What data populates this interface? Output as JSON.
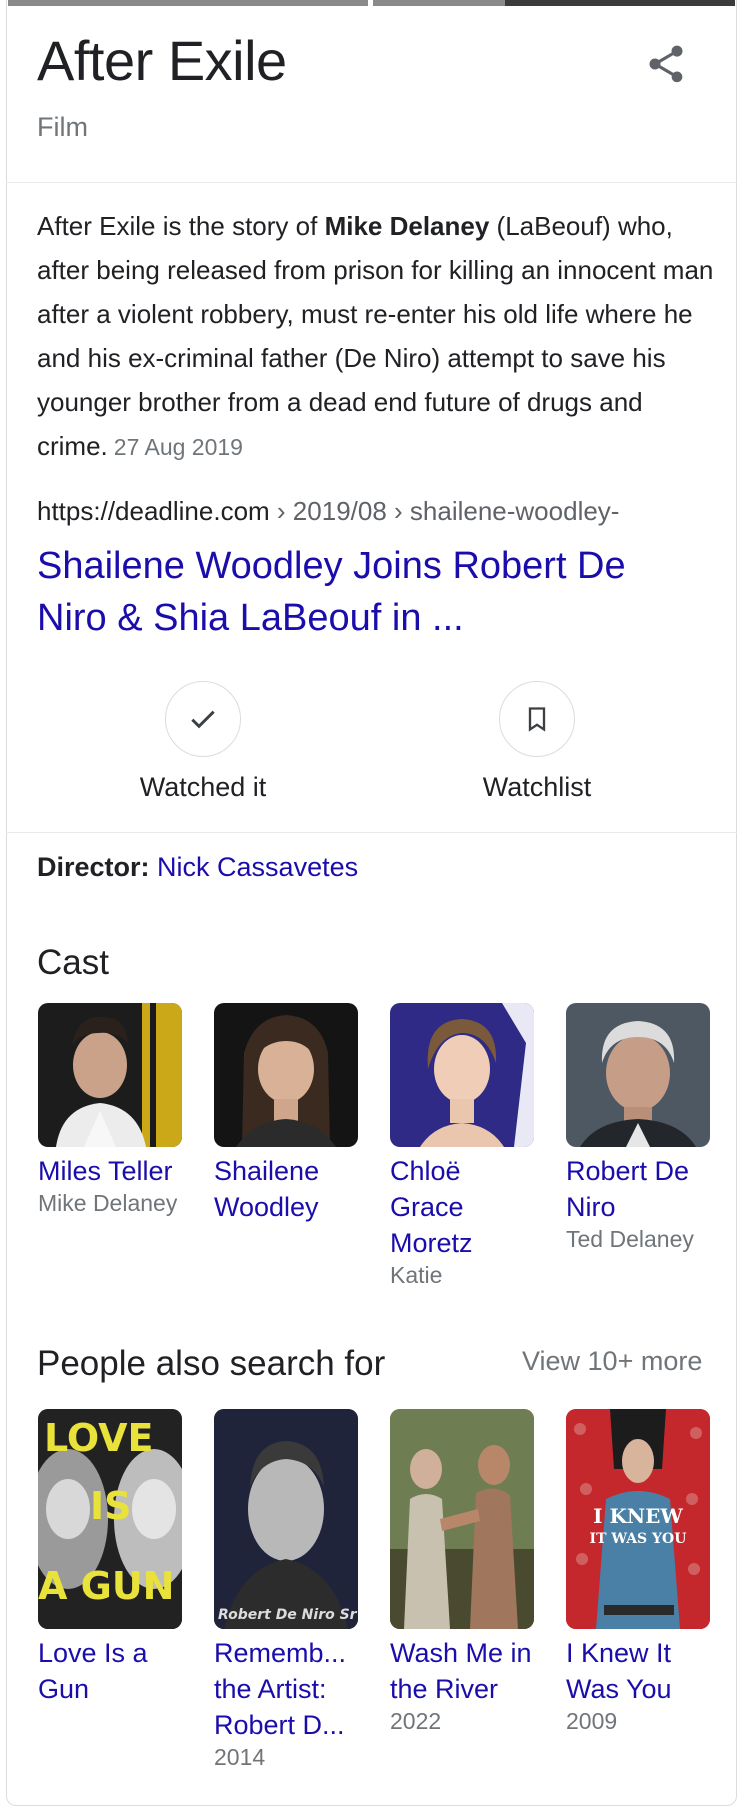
{
  "header": {
    "title": "After Exile",
    "subtitle": "Film"
  },
  "share_icon": "share-icon",
  "description": {
    "pre": "After Exile is the story of ",
    "bold": "Mike Delaney",
    "post": " (LaBeouf) who, after being released from prison for killing an innocent man after a violent robbery, must re-enter his old life where he and his ex-criminal father (De Niro) attempt to save his younger brother from a dead end future of drugs and crime.",
    "date": "27 Aug 2019"
  },
  "source": {
    "domain": "https://deadline.com",
    "path": " › 2019/08 › shailene-woodley-",
    "headline": "Shailene Woodley Joins Robert De Niro & Shia LaBeouf in ..."
  },
  "actions": {
    "watched": {
      "label": "Watched it",
      "icon": "checkmark-icon"
    },
    "watchlist": {
      "label": "Watchlist",
      "icon": "bookmark-icon"
    }
  },
  "director": {
    "label": "Director:",
    "name": "Nick Cassavetes"
  },
  "cast": {
    "title": "Cast",
    "items": [
      {
        "name": "Miles Teller",
        "role": "Mike Delaney"
      },
      {
        "name": "Shailene Woodley",
        "role": ""
      },
      {
        "name": "Chloë Grace Moretz",
        "role": "Katie"
      },
      {
        "name": "Robert De Niro",
        "role": "Ted Delaney"
      }
    ]
  },
  "people_also": {
    "title": "People also search for",
    "view_more": "View 10+ more",
    "items": [
      {
        "name": "Love Is a Gun",
        "year": "",
        "poster_line1": "LOVE",
        "poster_line2": "IS",
        "poster_line3": "A GUN"
      },
      {
        "name": "Rememb... the Artist: Robert D...",
        "year": "2014",
        "poster_caption": "Robert De Niro Sr"
      },
      {
        "name": "Wash Me in the River",
        "year": "2022"
      },
      {
        "name": "I Knew It Was You",
        "year": "2009",
        "poster_line1": "I KNEW",
        "poster_line2": "IT WAS YOU"
      }
    ]
  },
  "colors": {
    "link": "#1a0dab",
    "text": "#202124",
    "muted": "#70757a",
    "border": "#dadce0"
  }
}
